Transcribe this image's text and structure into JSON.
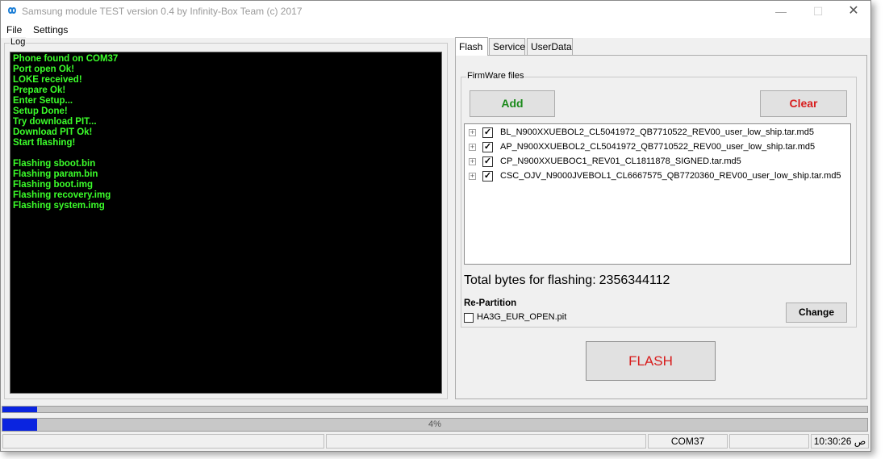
{
  "window": {
    "title": "Samsung module TEST version 0.4 by Infinity-Box Team (c) 2017",
    "minimize_glyph": "—",
    "maximize_glyph": "☐",
    "close_glyph": "✕"
  },
  "menu": {
    "file": "File",
    "settings": "Settings"
  },
  "log": {
    "legend": "Log",
    "lines": [
      "Phone found on COM37",
      "Port open Ok!",
      "LOKE received!",
      "Prepare Ok!",
      "Enter Setup...",
      "Setup Done!",
      "Try download PIT...",
      "Download PIT Ok!",
      "Start flashing!",
      "",
      "Flashing sboot.bin",
      "Flashing param.bin",
      "Flashing boot.img",
      "Flashing recovery.img",
      "Flashing system.img"
    ]
  },
  "tabs": {
    "flash": "Flash",
    "service": "Service",
    "userdata": "UserData"
  },
  "firmware": {
    "legend": "FirmWare files",
    "add_label": "Add",
    "clear_label": "Clear",
    "files": [
      {
        "name": "BL_N900XXUEBOL2_CL5041972_QB7710522_REV00_user_low_ship.tar.md5",
        "checked": true
      },
      {
        "name": "AP_N900XXUEBOL2_CL5041972_QB7710522_REV00_user_low_ship.tar.md5",
        "checked": true
      },
      {
        "name": "CP_N900XXUEBOC1_REV01_CL1811878_SIGNED.tar.md5",
        "checked": true
      },
      {
        "name": "CSC_OJV_N9000JVEBOL1_CL6667575_QB7720360_REV00_user_low_ship.tar.md5",
        "checked": true
      }
    ],
    "expander_glyph": "+",
    "check_glyph": "✓",
    "total_label": "Total bytes for flashing:",
    "total_value": "2356344112",
    "repartition_label": "Re-Partition",
    "pit_file": "HA3G_EUR_OPEN.pit",
    "pit_checked": false,
    "change_label": "Change"
  },
  "flash_button": "FLASH",
  "progress": {
    "top_fraction": 0.04,
    "main_fraction": 0.04,
    "main_text": "4%",
    "fill_color": "#0a24e0"
  },
  "status": {
    "cell1": "",
    "cell2": "",
    "port": "COM37",
    "cell4": "",
    "time": "10:30:26 ص"
  },
  "colors": {
    "log_text": "#3cff2b",
    "add": "#1a8a1a",
    "clear": "#d81c1c",
    "flash": "#d81c1c"
  }
}
